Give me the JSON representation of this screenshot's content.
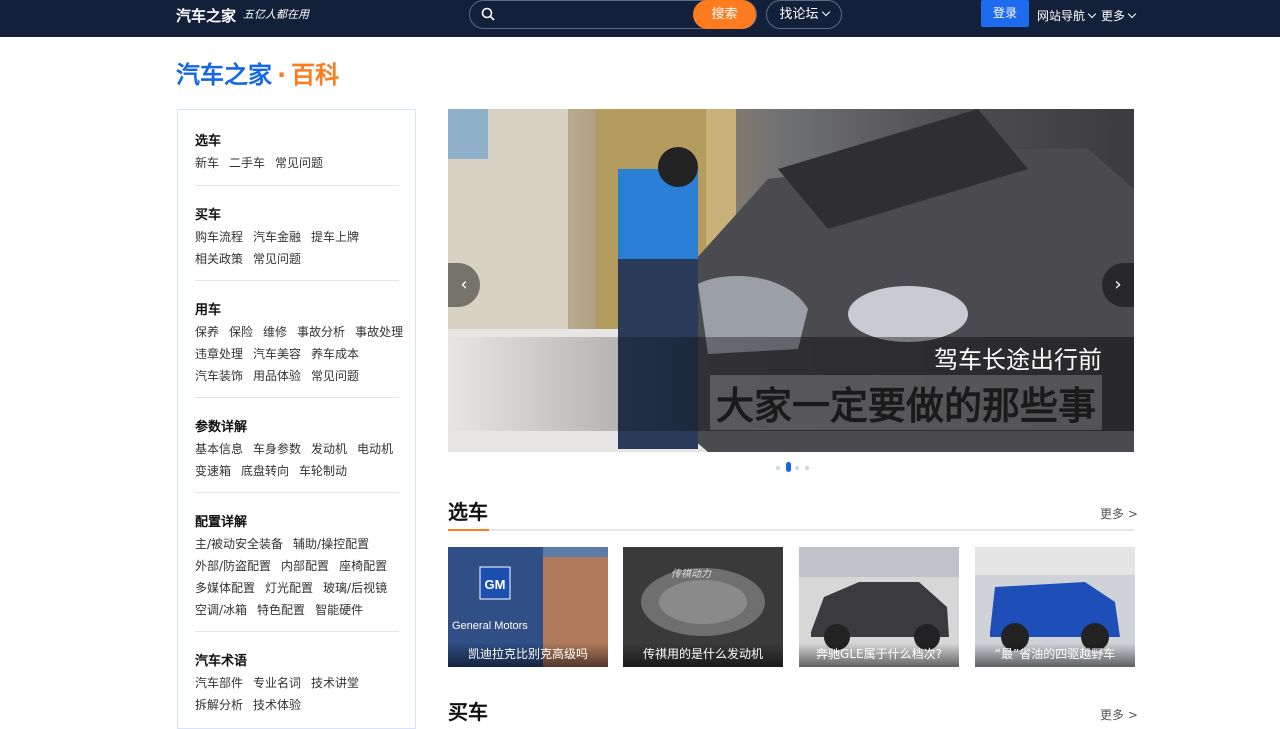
{
  "topbar": {
    "brand": "汽车之家",
    "slogan": "五亿人都在用",
    "search_placeholder": "",
    "search_button": "搜索",
    "forum_button": "找论坛",
    "login_button": "登录",
    "site_nav": "网站导航",
    "more": "更多"
  },
  "logo": {
    "brand": "汽车之家",
    "dot": "·",
    "subtitle": "百科"
  },
  "sidebar": {
    "sections": [
      {
        "title": "选车",
        "lines": [
          [
            "新车",
            "二手车",
            "常见问题"
          ]
        ]
      },
      {
        "title": "买车",
        "lines": [
          [
            "购车流程",
            "汽车金融",
            "提车上牌"
          ],
          [
            "相关政策",
            "常见问题"
          ]
        ]
      },
      {
        "title": "用车",
        "lines": [
          [
            "保养",
            "保险",
            "维修",
            "事故分析",
            "事故处理"
          ],
          [
            "违章处理",
            "汽车美容",
            "养车成本"
          ],
          [
            "汽车装饰",
            "用品体验",
            "常见问题"
          ]
        ]
      },
      {
        "title": "参数详解",
        "lines": [
          [
            "基本信息",
            "车身参数",
            "发动机",
            "电动机"
          ],
          [
            "变速箱",
            "底盘转向",
            "车轮制动"
          ]
        ]
      },
      {
        "title": "配置详解",
        "lines": [
          [
            "主/被动安全装备",
            "辅助/操控配置"
          ],
          [
            "外部/防盗配置",
            "内部配置",
            "座椅配置"
          ],
          [
            "多媒体配置",
            "灯光配置",
            "玻璃/后视镜"
          ],
          [
            "空调/冰箱",
            "特色配置",
            "智能硬件"
          ]
        ]
      },
      {
        "title": "汽车术语",
        "lines": [
          [
            "汽车部件",
            "专业名词",
            "技术讲堂"
          ],
          [
            "拆解分析",
            "技术体验"
          ]
        ]
      }
    ]
  },
  "banner": {
    "caption_small": "驾车长途出行前",
    "caption_large": "大家一定要做的那些事",
    "prev": "‹",
    "next": "›",
    "active_slide": 2,
    "slide_count": 4
  },
  "sections": {
    "choose": {
      "title": "选车",
      "more": "更多 >",
      "cards": [
        {
          "caption": "凯迪拉克比别克高级吗",
          "sign_text": "General Motors",
          "logo_text": "GM"
        },
        {
          "caption": "传祺用的是什么发动机",
          "sign_text": "传祺动力"
        },
        {
          "caption": "奔驰GLE属于什么档次?"
        },
        {
          "caption": "“最”省油的四驱越野车"
        }
      ]
    },
    "buy": {
      "title": "买车",
      "more": "更多 >"
    }
  }
}
